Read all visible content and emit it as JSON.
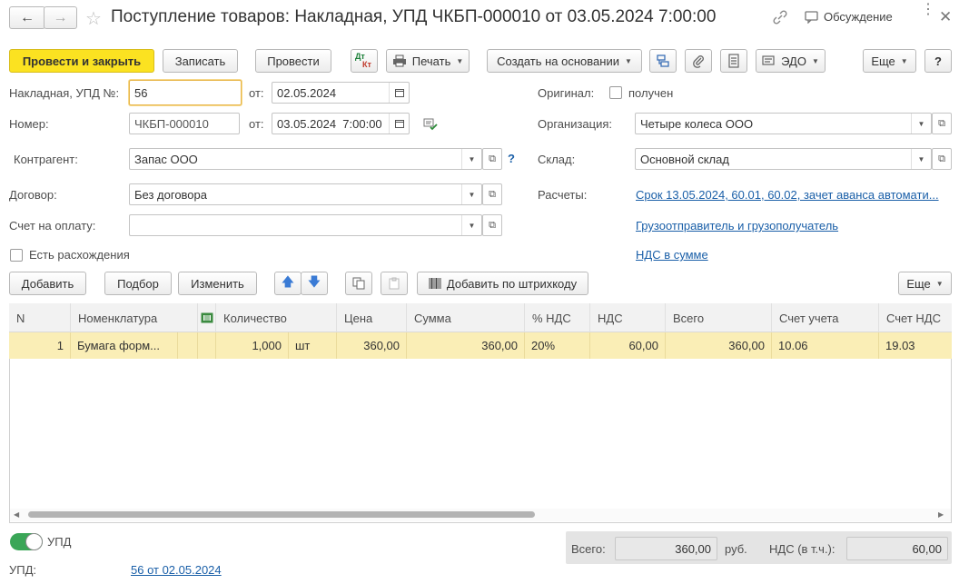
{
  "window": {
    "title": "Поступление товаров: Накладная, УПД ЧКБП-000010 от 03.05.2024 7:00:00",
    "discussion_label": "Обсуждение"
  },
  "toolbar": {
    "post_close": "Провести и закрыть",
    "save": "Записать",
    "post": "Провести",
    "dtkt_top": "Дт",
    "dtkt_bottom": "Кт",
    "print": "Печать",
    "create_based": "Создать на основании",
    "edo": "ЭДО",
    "more": "Еще",
    "help": "?"
  },
  "form": {
    "invoice_label": "Накладная, УПД №:",
    "invoice_number": "56",
    "invoice_from_label": "от:",
    "invoice_date": "02.05.2024",
    "number_label": "Номер:",
    "number_value": "ЧКБП-000010",
    "number_from_label": "от:",
    "number_date": "03.05.2024  7:00:00",
    "counterparty_label": "Контрагент:",
    "counterparty_value": "Запас ООО",
    "counterparty_help": "?",
    "contract_label": "Договор:",
    "contract_value": "Без договора",
    "payment_account_label": "Счет на оплату:",
    "payment_account_value": "",
    "discrepancies_label": "Есть расхождения",
    "original_label": "Оригинал:",
    "original_received_label": "получен",
    "organization_label": "Организация:",
    "organization_value": "Четыре колеса ООО",
    "warehouse_label": "Склад:",
    "warehouse_value": "Основной склад",
    "settlements_label": "Расчеты:",
    "settlements_link": "Срок 13.05.2024, 60.01, 60.02, зачет аванса автомати...",
    "shipper_link": "Грузоотправитель и грузополучатель",
    "vat_link": "НДС в сумме"
  },
  "table_toolbar": {
    "add": "Добавить",
    "pick": "Подбор",
    "edit": "Изменить",
    "add_barcode": "Добавить по штрихкоду",
    "more": "Еще"
  },
  "table": {
    "columns": [
      "N",
      "Номенклатура",
      "Количество",
      "Цена",
      "Сумма",
      "% НДС",
      "НДС",
      "Всего",
      "Счет учета",
      "Счет НДС"
    ],
    "rows": [
      {
        "n": "1",
        "item": "Бумага форм...",
        "qty": "1,000",
        "unit": "шт",
        "price": "360,00",
        "sum": "360,00",
        "vat_rate": "20%",
        "vat": "60,00",
        "total": "360,00",
        "account": "10.06",
        "vat_account": "19.03"
      }
    ]
  },
  "footer": {
    "upd_toggle_label": "УПД",
    "upd_label": "УПД:",
    "upd_link": "56 от 02.05.2024",
    "total_label": "Всего:",
    "total_value": "360,00",
    "currency": "руб.",
    "vat_label": "НДС (в т.ч.):",
    "vat_value": "60,00"
  },
  "colors": {
    "primary_button": "#fbe221",
    "link": "#1a5fa8",
    "selected_row": "#faeeb6",
    "toggle_on": "#3aa657"
  }
}
